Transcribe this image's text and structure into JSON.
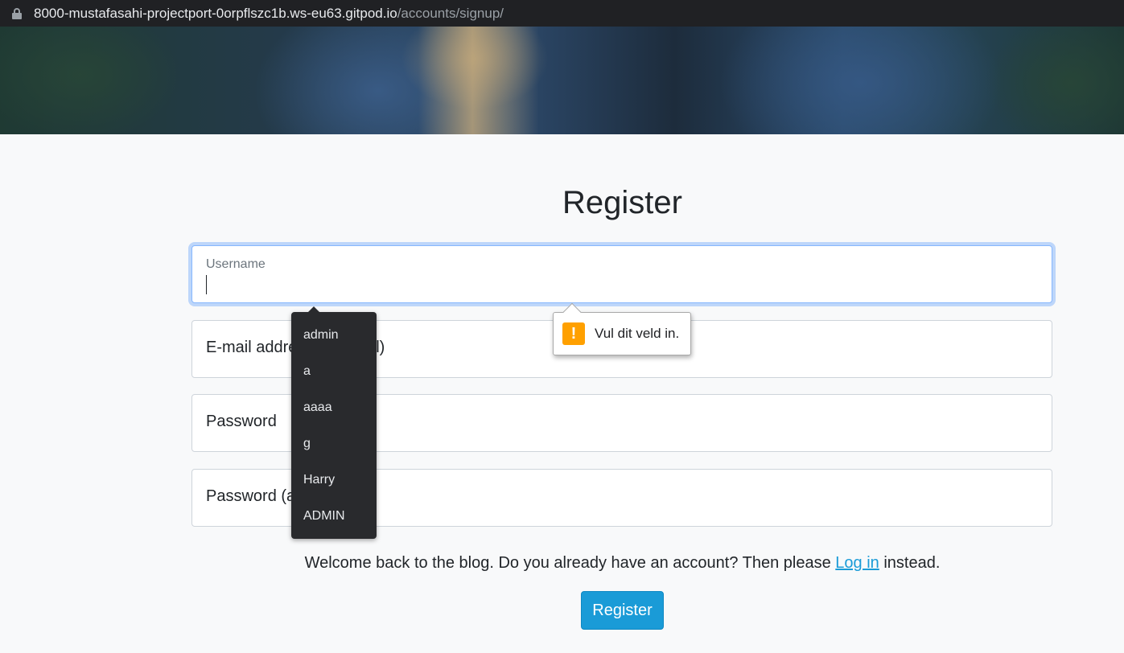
{
  "browser": {
    "url_host": "8000-mustafasahi-projectport-0orpflszc1b.ws-eu63.gitpod.io",
    "url_path": "/accounts/signup/"
  },
  "page": {
    "title": "Register",
    "fields": {
      "username": "Username",
      "email": "E-mail address (optional)",
      "password": "Password",
      "password_again": "Password (again)"
    },
    "note_before": "Welcome back to the blog. Do you already have an account? Then please ",
    "login_link": "Log in",
    "note_after": " instead.",
    "submit": "Register"
  },
  "autocomplete": [
    "admin",
    "a",
    "aaaa",
    "g",
    "Harry",
    "ADMIN"
  ],
  "validation": {
    "message": "Vul dit veld in.",
    "icon": "warning-icon"
  },
  "colors": {
    "button": "#1a9bd7",
    "focus_border": "#86b7fe",
    "warning": "#ffa000"
  }
}
